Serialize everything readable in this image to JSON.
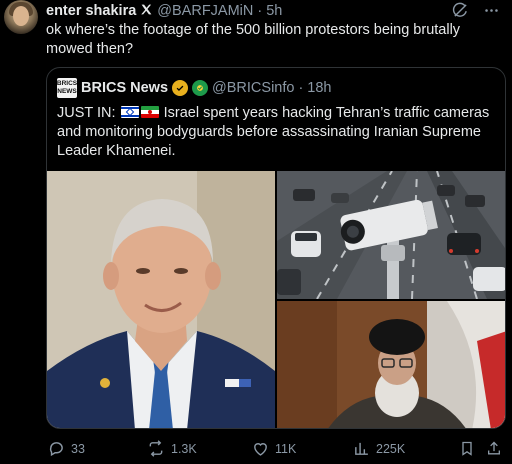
{
  "post": {
    "author_name": "enter shakira",
    "author_handle": "@BARFJAMiN",
    "separator": "·",
    "time": "5h",
    "text": "ok where’s the footage of the 500 billion protestors being brutally mowed then?"
  },
  "quote": {
    "logo_lines": [
      "BRICS",
      "NEWS"
    ],
    "name": "BRICS News",
    "handle": "@BRICSinfo",
    "separator": "·",
    "time": "18h",
    "text_prefix": "JUST IN:",
    "text_body": "Israel spent years hacking Tehran’s traffic cameras and monitoring bodyguards before assassinating Iranian Supreme Leader Khamenei."
  },
  "actions": {
    "replies": "33",
    "reposts": "1.3K",
    "likes": "11K",
    "views": "225K"
  },
  "colors": {
    "background": "#000000",
    "text": "#e7e9ea",
    "muted": "#8b98a5",
    "border": "#2f3336",
    "gold_badge": "#e8b01e",
    "green_badge": "#1d9a4a"
  },
  "icons": {
    "top": [
      "grok-icon",
      "more-icon"
    ],
    "author_badge": "x-logo-icon",
    "actions": [
      "reply-icon",
      "repost-icon",
      "like-icon",
      "views-icon",
      "bookmark-icon",
      "share-icon"
    ]
  }
}
